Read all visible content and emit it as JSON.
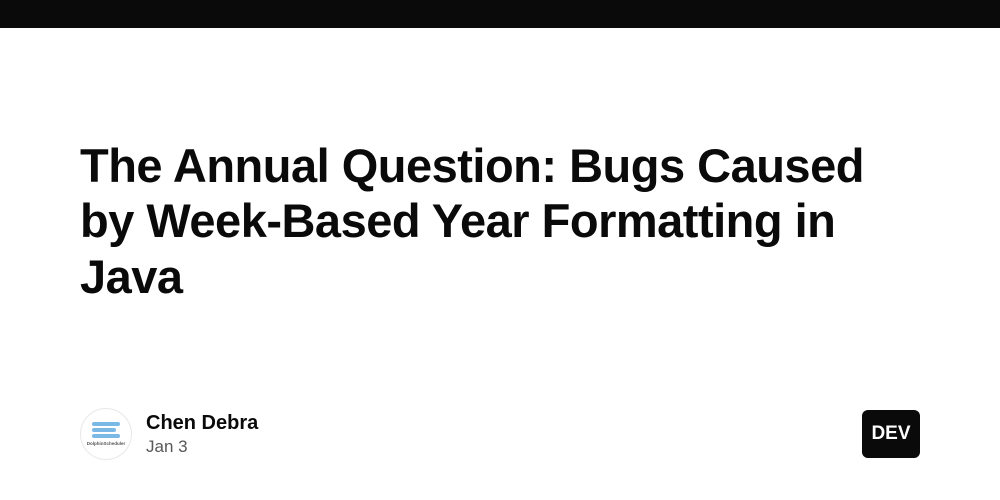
{
  "article": {
    "title": "The Annual Question: Bugs Caused by Week-Based Year Formatting in Java"
  },
  "author": {
    "name": "Chen Debra",
    "avatar_label": "DolphinScheduler",
    "date": "Jan 3"
  },
  "badge": {
    "text": "DEV"
  }
}
